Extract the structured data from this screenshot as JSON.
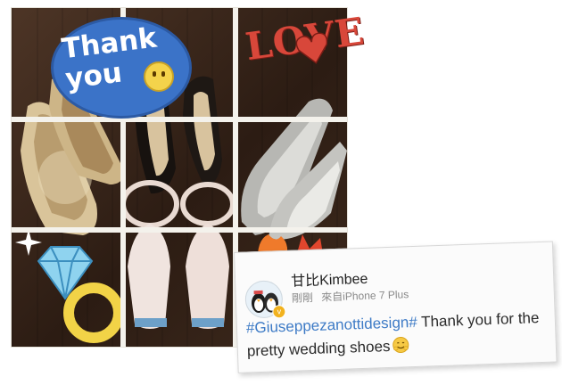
{
  "collage": {
    "thanks_text": "Thank\nyou",
    "love_text": "LOVE"
  },
  "post": {
    "username": "甘比Kimbee",
    "time": "剛剛",
    "source": "來自iPhone 7 Plus",
    "hashtag": "#Giuseppezanottidesign#",
    "message": " Thank you for the pretty wedding shoes",
    "emoji": "smiling-face-emoji"
  },
  "colors": {
    "hashtag": "#3e7bc6",
    "thanks_bubble": "#3b73c8",
    "love": "#d8473a"
  }
}
